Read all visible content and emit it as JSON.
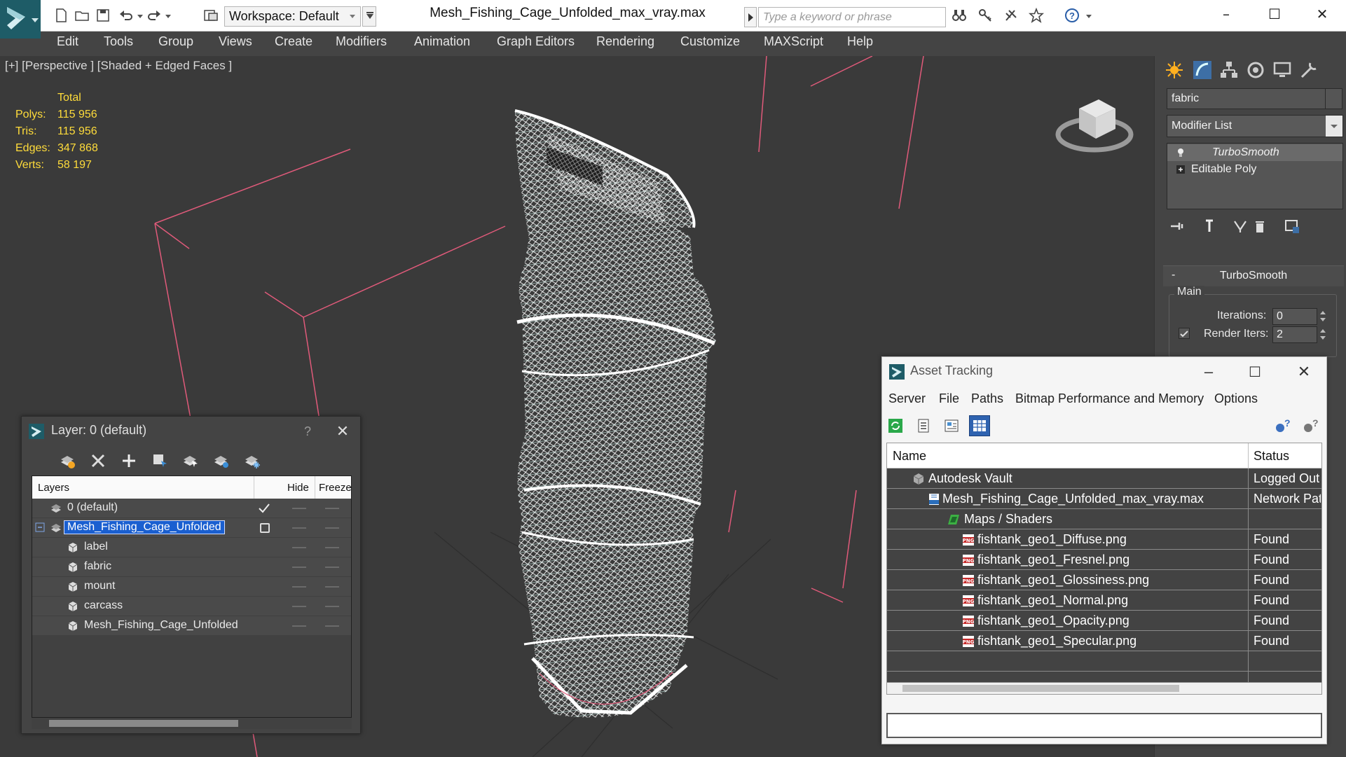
{
  "titlebar": {
    "workspace": "Workspace: Default",
    "document_title": "Mesh_Fishing_Cage_Unfolded_max_vray.max",
    "search_placeholder": "Type a keyword or phrase",
    "minimize": "–",
    "maximize": "☐",
    "close": "✕"
  },
  "menu": [
    "Edit",
    "Tools",
    "Group",
    "Views",
    "Create",
    "Modifiers",
    "Animation",
    "Graph Editors",
    "Rendering",
    "Customize",
    "MAXScript",
    "Help"
  ],
  "viewport": {
    "label": "[+] [Perspective ] [Shaded + Edged Faces ]",
    "stats_header": "Total",
    "stats": [
      {
        "key": "Polys:",
        "value": "115 956"
      },
      {
        "key": "Tris:",
        "value": "115 956"
      },
      {
        "key": "Edges:",
        "value": "347 868"
      },
      {
        "key": "Verts:",
        "value": "58 197"
      }
    ]
  },
  "command_panel": {
    "object_name": "fabric",
    "modifier_list": "Modifier List",
    "stack": [
      "TurboSmooth",
      "Editable Poly"
    ],
    "rollout_title": "TurboSmooth",
    "group_label": "Main",
    "iterations_label": "Iterations:",
    "iterations_value": "0",
    "render_iters_label": "Render Iters:",
    "render_iters_value": "2"
  },
  "layer_dialog": {
    "title": "Layer: 0 (default)",
    "help": "?",
    "close": "✕",
    "columns": {
      "layers": "Layers",
      "hide": "Hide",
      "freeze": "Freeze"
    },
    "rows": [
      {
        "label": "0 (default)"
      },
      {
        "label": "Mesh_Fishing_Cage_Unfolded"
      },
      {
        "label": "label"
      },
      {
        "label": "fabric"
      },
      {
        "label": "mount"
      },
      {
        "label": "carcass"
      },
      {
        "label": "Mesh_Fishing_Cage_Unfolded"
      }
    ]
  },
  "asset_dialog": {
    "title": "Asset Tracking",
    "menu": [
      "Server",
      "File",
      "Paths",
      "Bitmap Performance and Memory",
      "Options"
    ],
    "columns": {
      "name": "Name",
      "status": "Status"
    },
    "rows": [
      {
        "name": "Autodesk Vault",
        "status": "Logged Out ..."
      },
      {
        "name": "Mesh_Fishing_Cage_Unfolded_max_vray.max",
        "status": "Network Path"
      },
      {
        "name": "Maps / Shaders",
        "status": ""
      },
      {
        "name": "fishtank_geo1_Diffuse.png",
        "status": "Found"
      },
      {
        "name": "fishtank_geo1_Fresnel.png",
        "status": "Found"
      },
      {
        "name": "fishtank_geo1_Glossiness.png",
        "status": "Found"
      },
      {
        "name": "fishtank_geo1_Normal.png",
        "status": "Found"
      },
      {
        "name": "fishtank_geo1_Opacity.png",
        "status": "Found"
      },
      {
        "name": "fishtank_geo1_Specular.png",
        "status": "Found"
      }
    ]
  },
  "colors": {
    "accent": "#1a5fd0",
    "grid_red": "#e05a7a",
    "stat_yellow": "#ffdc3a",
    "wire_white": "#ffffff"
  }
}
